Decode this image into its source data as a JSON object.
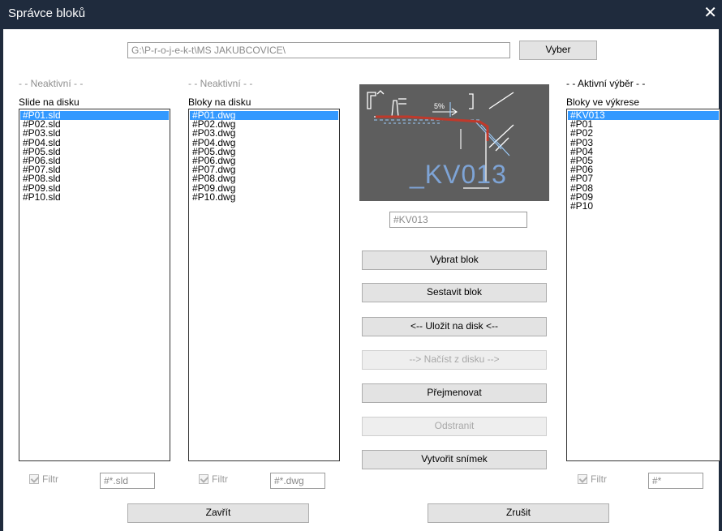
{
  "window": {
    "title": "Správce bloků",
    "close_glyph": "✕"
  },
  "path": {
    "value": "G:\\P-r-o-j-e-k-t\\MS JAKUBCOVICE\\",
    "browse_label": "Vyber"
  },
  "left_panel": {
    "status": "- - Neaktivní - -",
    "header": "Slide na disku",
    "items": [
      "#P01.sld",
      "#P02.sld",
      "#P03.sld",
      "#P04.sld",
      "#P05.sld",
      "#P06.sld",
      "#P07.sld",
      "#P08.sld",
      "#P09.sld",
      "#P10.sld"
    ],
    "selected_index": 0,
    "filter_label": "Filtr",
    "filter_value": "#*.sld"
  },
  "middle_panel": {
    "status": "- - Neaktivní - -",
    "header": "Bloky na disku",
    "items": [
      "#P01.dwg",
      "#P02.dwg",
      "#P03.dwg",
      "#P04.dwg",
      "#P05.dwg",
      "#P06.dwg",
      "#P07.dwg",
      "#P08.dwg",
      "#P09.dwg",
      "#P10.dwg"
    ],
    "selected_index": 0,
    "filter_label": "Filtr",
    "filter_value": "#*.dwg"
  },
  "right_panel": {
    "status": "- - Aktivní výběr - -",
    "header": "Bloky ve výkrese",
    "items": [
      "#KV013",
      "#P01",
      "#P02",
      "#P03",
      "#P04",
      "#P05",
      "#P06",
      "#P07",
      "#P08",
      "#P09",
      "#P10"
    ],
    "selected_index": 0,
    "filter_label": "Filtr",
    "filter_value": "#*"
  },
  "preview": {
    "caption": "_KV013",
    "slope": "5%",
    "bg_color": "#5e5e5e",
    "line_color": "#c0392b"
  },
  "block_name": "#KV013",
  "actions": {
    "select_block": "Vybrat blok",
    "build_block": "Sestavit blok",
    "save_to_disk": "<-- Uložit na disk <--",
    "load_from_disk": "--> Načíst z disku -->",
    "rename": "Přejmenovat",
    "remove": "Odstranit",
    "make_snapshot": "Vytvořit snímek"
  },
  "footer": {
    "close": "Zavřít",
    "cancel": "Zrušit"
  }
}
